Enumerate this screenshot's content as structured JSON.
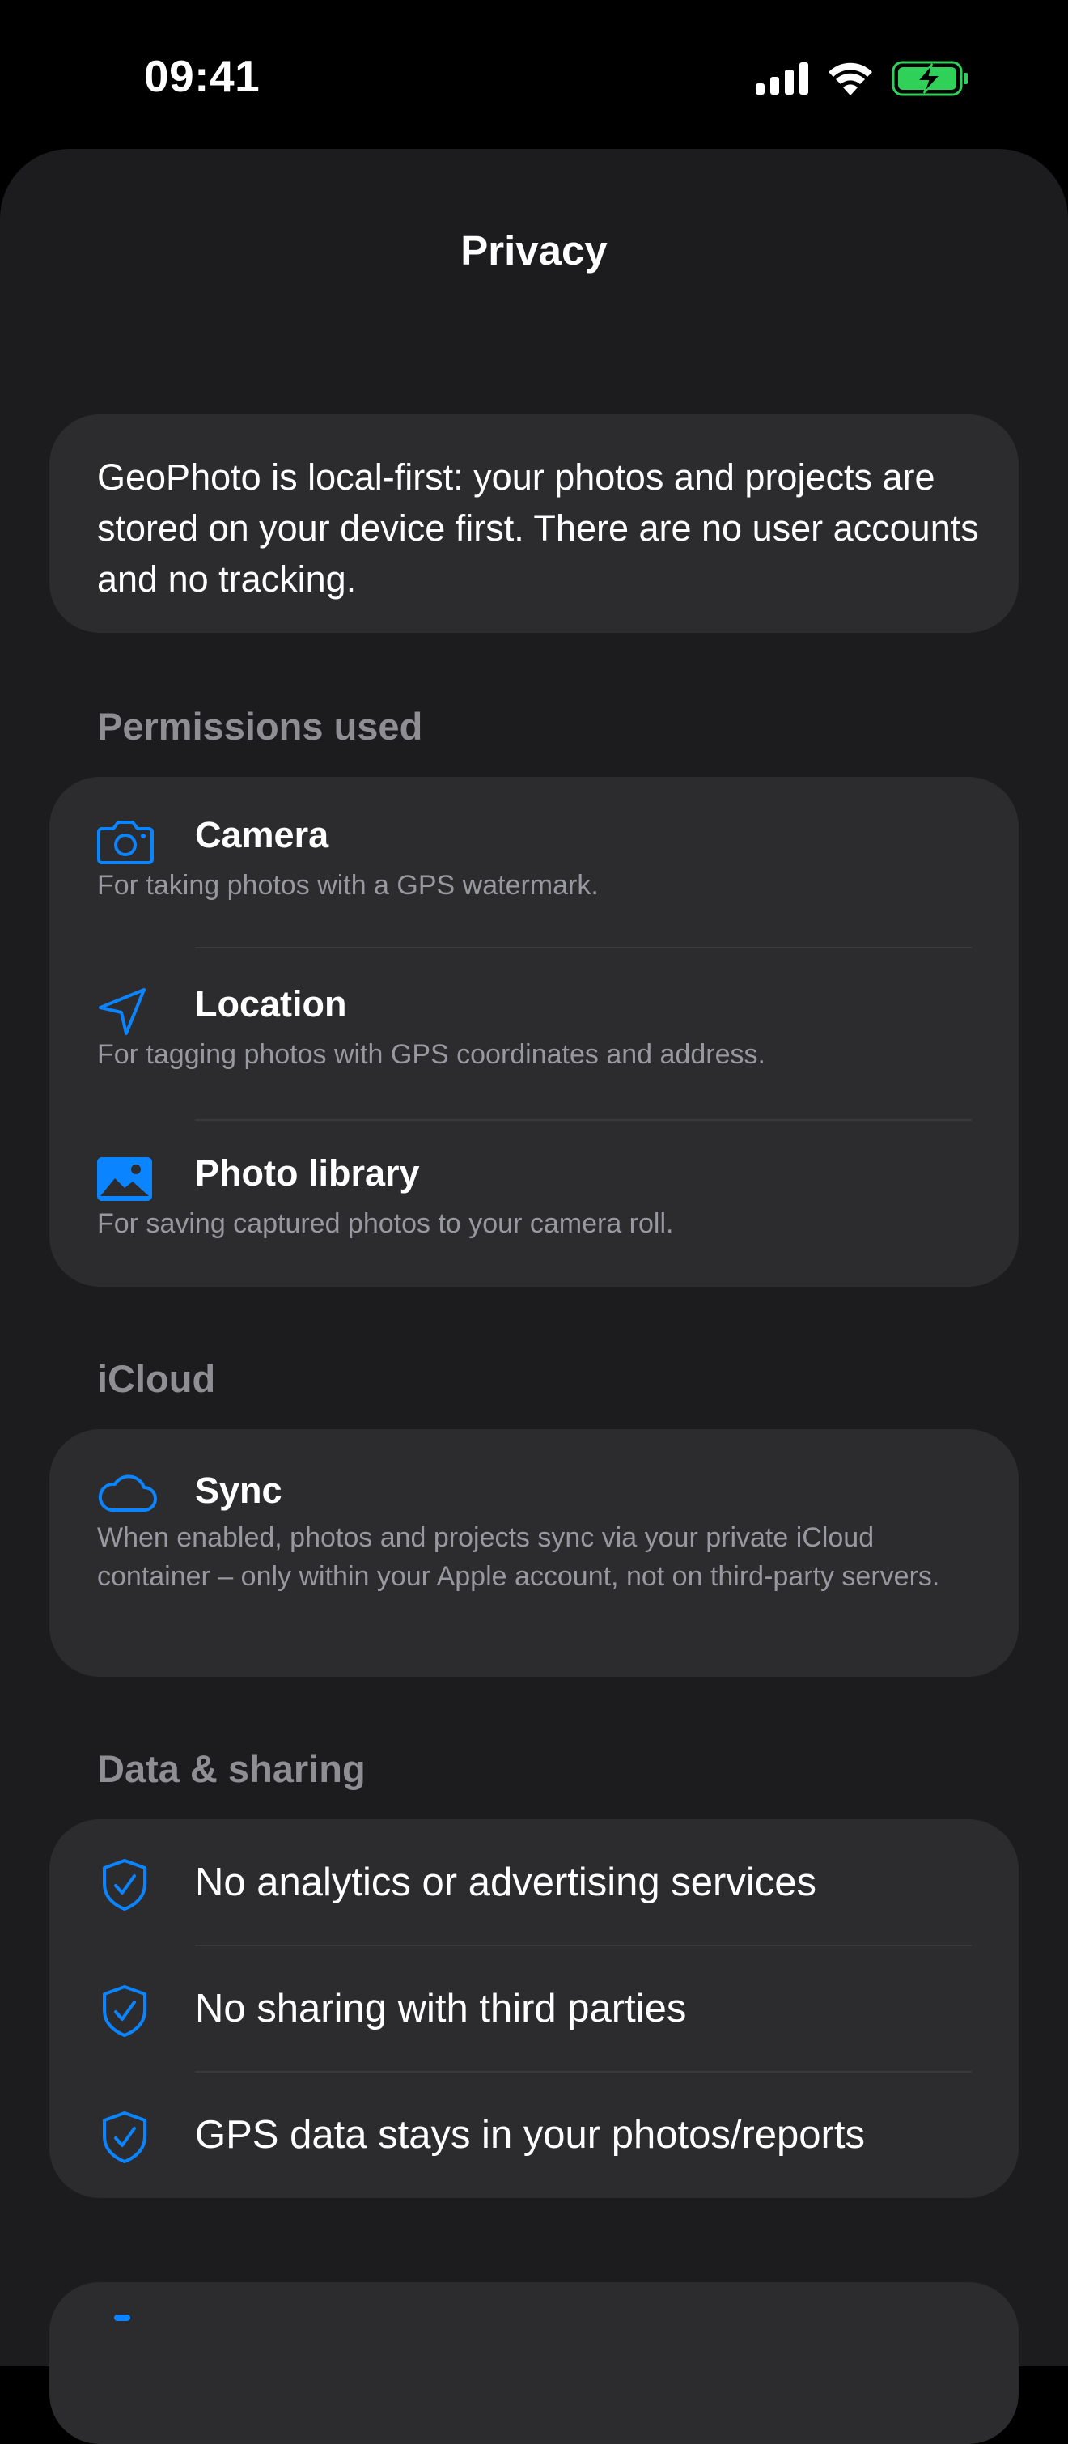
{
  "status_bar": {
    "time": "09:41"
  },
  "nav": {
    "title": "Privacy"
  },
  "intro": {
    "text": "GeoPhoto is local-first: your photos and projects are stored on your device first. There are no user accounts and no tracking."
  },
  "permissions": {
    "header": "Permissions used",
    "items": [
      {
        "icon": "camera-icon",
        "title": "Camera",
        "description": "For taking photos with a GPS watermark."
      },
      {
        "icon": "location-arrow-icon",
        "title": "Location",
        "description": "For tagging photos with GPS coordinates and address."
      },
      {
        "icon": "photo-library-icon",
        "title": "Photo library",
        "description": "For saving captured photos to your camera roll."
      }
    ]
  },
  "icloud": {
    "header": "iCloud",
    "item": {
      "icon": "cloud-icon",
      "title": "Sync",
      "description": "When enabled, photos and projects sync via your private iCloud container – only within your Apple account, not on third-party servers."
    }
  },
  "data_sharing": {
    "header": "Data & sharing",
    "items": [
      {
        "icon": "shield-check-icon",
        "label": "No analytics or advertising services"
      },
      {
        "icon": "shield-check-icon",
        "label": "No sharing with third parties"
      },
      {
        "icon": "shield-check-icon",
        "label": "GPS data stays in your photos/reports"
      }
    ]
  },
  "colors": {
    "accent": "#0a84ff",
    "background": "#1c1c1e",
    "card": "#2c2c2e",
    "secondary_text": "#98989f",
    "battery_green": "#30d158"
  }
}
